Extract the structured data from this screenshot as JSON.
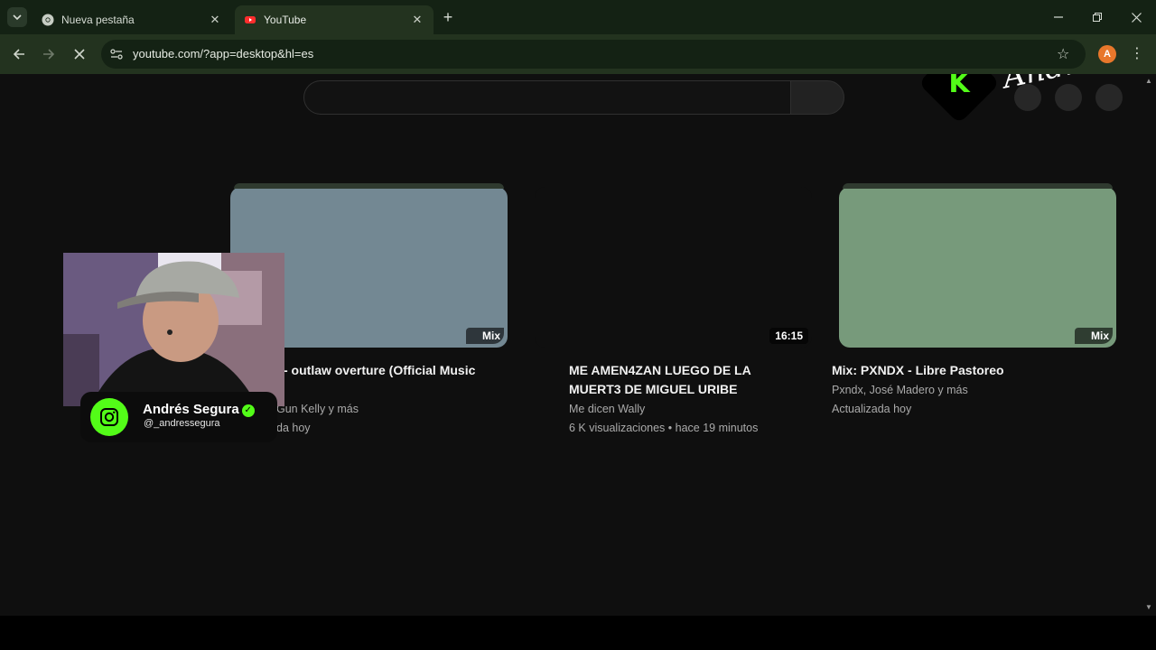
{
  "tabs": [
    {
      "title": "Nueva pestaña",
      "active": false,
      "icon": "chrome-icon"
    },
    {
      "title": "YouTube",
      "active": true,
      "icon": "youtube-icon"
    }
  ],
  "address_bar": {
    "url": "youtube.com/?app=desktop&hl=es"
  },
  "profile": {
    "initial": "A",
    "color": "#e8772b"
  },
  "overlay": {
    "kick_letter": "K",
    "script_text": "Andr",
    "instagram": {
      "name": "Andrés Segura",
      "handle": "@_andressegura"
    }
  },
  "videos": [
    {
      "title": "- outlaw overture (Official Music",
      "channel": "Gun Kelly y más",
      "meta": "da hoy",
      "badge": "Mix",
      "thumb_color": "#738893"
    },
    {
      "title": "ME AMEN4ZAN LUEGO DE LA MUERT3 DE MIGUEL URIBE",
      "channel": "Me dicen Wally",
      "meta": "6 K visualizaciones • hace 19 minutos",
      "badge": "16:15",
      "thumb_color": "#0f0f0f"
    },
    {
      "title": "Mix: PXNDX - Libre Pastoreo",
      "channel": "Pxndx, José Madero y más",
      "meta": "Actualizada hoy",
      "badge": "Mix",
      "thumb_color": "#779a7b"
    }
  ],
  "colors": {
    "brand_green": "#53fc18",
    "page_bg": "#0f0f0f",
    "chrome_bg": "#23331f"
  }
}
